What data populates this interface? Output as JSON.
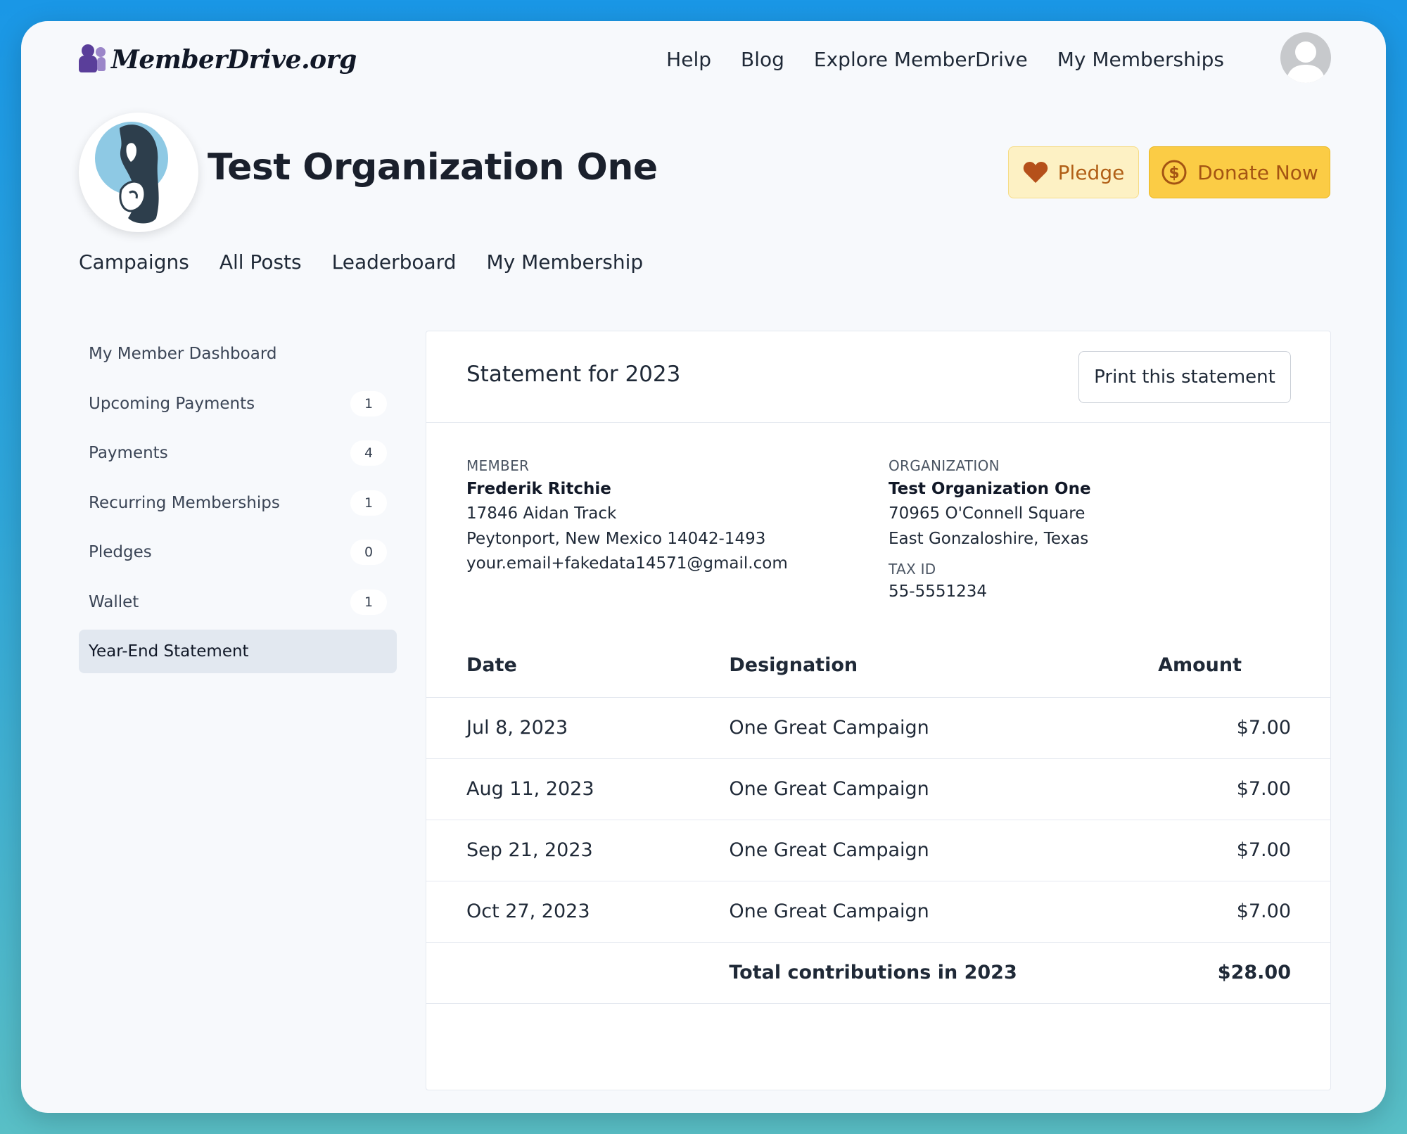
{
  "nav": {
    "logo_text": "MemberDrive.org",
    "links": [
      "Help",
      "Blog",
      "Explore MemberDrive",
      "My Memberships"
    ]
  },
  "org": {
    "name": "Test Organization One",
    "pledge_label": "Pledge",
    "donate_label": "Donate Now",
    "tabs": [
      "Campaigns",
      "All Posts",
      "Leaderboard",
      "My Membership"
    ]
  },
  "sidebar": {
    "items": [
      {
        "label": "My Member Dashboard",
        "count": null
      },
      {
        "label": "Upcoming Payments",
        "count": "1"
      },
      {
        "label": "Payments",
        "count": "4"
      },
      {
        "label": "Recurring Memberships",
        "count": "1"
      },
      {
        "label": "Pledges",
        "count": "0"
      },
      {
        "label": "Wallet",
        "count": "1"
      },
      {
        "label": "Year-End Statement",
        "count": null
      }
    ]
  },
  "statement": {
    "title": "Statement for 2023",
    "print_label": "Print this statement",
    "member": {
      "label": "MEMBER",
      "name": "Frederik Ritchie",
      "address1": "17846 Aidan Track",
      "address2": "Peytonport, New Mexico 14042-1493",
      "email": "your.email+fakedata14571@gmail.com"
    },
    "organization": {
      "label": "ORGANIZATION",
      "name": "Test Organization One",
      "address1": "70965 O'Connell Square",
      "address2": "East Gonzaloshire, Texas",
      "tax_label": "TAX ID",
      "tax_id": "55-5551234"
    },
    "table": {
      "headers": [
        "Date",
        "Designation",
        "Amount"
      ],
      "rows": [
        {
          "date": "Jul 8, 2023",
          "designation": "One Great Campaign",
          "amount": "$7.00"
        },
        {
          "date": "Aug 11, 2023",
          "designation": "One Great Campaign",
          "amount": "$7.00"
        },
        {
          "date": "Sep 21, 2023",
          "designation": "One Great Campaign",
          "amount": "$7.00"
        },
        {
          "date": "Oct 27, 2023",
          "designation": "One Great Campaign",
          "amount": "$7.00"
        }
      ],
      "total_label": "Total contributions in 2023",
      "total_amount": "$28.00"
    }
  },
  "colors": {
    "pledge_bg": "#fdf1c4",
    "donate_bg": "#fbcc45",
    "active_sidebar_bg": "#e2e8f0"
  }
}
